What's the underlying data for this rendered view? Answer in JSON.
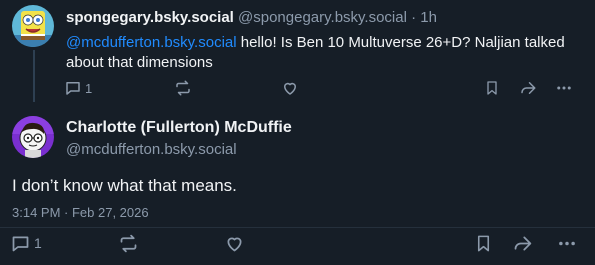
{
  "parent": {
    "display_name": "spongegary.bsky.social",
    "handle": "@spongegary.bsky.social",
    "separator": "·",
    "age": "1h",
    "mention": "@mcdufferton.bsky.social",
    "text": " hello! Is Ben 10 Multuverse 26+D? Naljian talked about that dimensions",
    "reply_count": "1",
    "icons": [
      "reply-icon",
      "repost-icon",
      "like-icon",
      "bookmark-icon",
      "share-icon",
      "more-icon"
    ]
  },
  "post": {
    "display_name": "Charlotte (Fullerton) McDuffie",
    "handle": "@mcdufferton.bsky.social",
    "text": "I don’t know what that means.",
    "timestamp": "3:14 PM · Feb 27, 2026",
    "reply_count": "1"
  },
  "colors": {
    "background": "#161e27",
    "text": "#f1f3f5",
    "muted": "#8c9aab",
    "link": "#208bfe"
  }
}
